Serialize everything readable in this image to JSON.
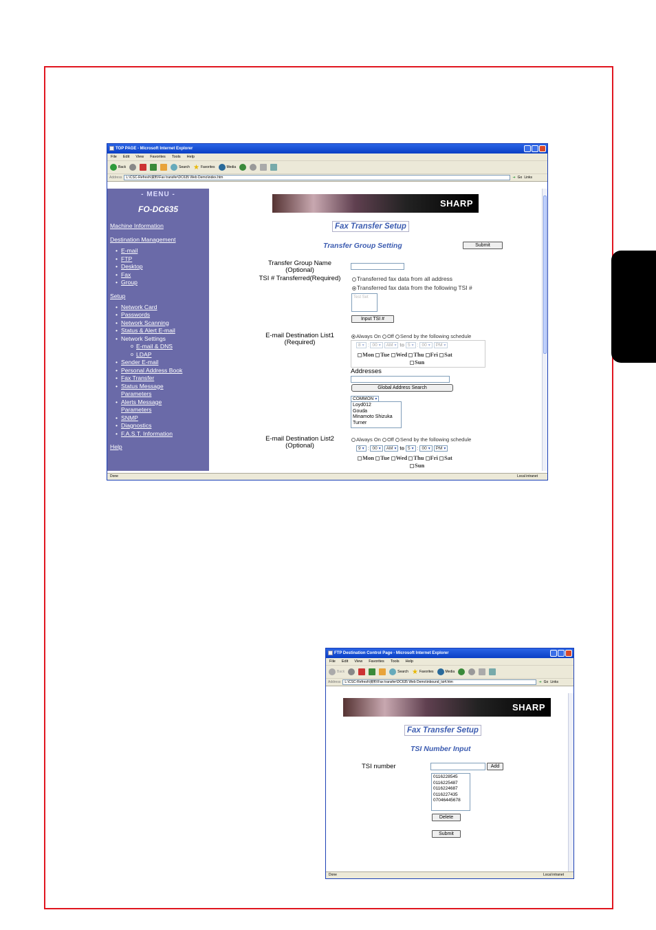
{
  "win1": {
    "title": "TOP PAGE - Microsoft Internet Explorer",
    "menus": [
      "File",
      "Edit",
      "View",
      "Favorites",
      "Tools",
      "Help"
    ],
    "toolbar": {
      "back": "Back",
      "search": "Search",
      "favorites": "Favorites",
      "media": "Media"
    },
    "address_label": "Address",
    "address": "L:\\CSC-Refresh\\資料\\Fax transfer\\DC635 Web Demo\\index.htm",
    "go": "Go",
    "links": "Links",
    "status_left": "Done",
    "status_right": "Local intranet",
    "sidebar": {
      "menu": "- MENU -",
      "model": "FO-DC635",
      "machine_info": "Machine Information",
      "destination": "Destination Management",
      "dest_items": [
        "E-mail",
        "FTP",
        "Desktop",
        "Fax",
        "Group"
      ],
      "setup": "Setup",
      "setup_items": [
        "Network Card",
        "Passwords",
        "Network Scanning",
        "Status & Alert E-mail",
        "Network Settings"
      ],
      "net_sub": [
        "E-mail & DNS",
        "LDAP"
      ],
      "setup_items2": [
        "Sender E-mail",
        "Personal Address Book",
        "Fax Transfer",
        "Status Message",
        "Parameters",
        "Alerts Message",
        "Parameters",
        "SNMP",
        "Diagnostics",
        "F.A.S.T. Information"
      ],
      "help": "Help"
    },
    "brand": "SHARP",
    "page_title": "Fax Transfer Setup",
    "section": "Transfer Group Setting",
    "submit": "Submit",
    "group_name_label": "Transfer Group Name\n(Optional)",
    "tsi_label": "TSI # Transferred(Required)",
    "tsi_opt1": "Transferred fax data from all address",
    "tsi_opt2": "Transferred fax data from the following TSI #",
    "tsi_list": "Test Set",
    "input_tsi": "Input TSI #",
    "list1_label": "E-mail Destination List1\n(Required)",
    "always_on": "Always On",
    "off": "Off",
    "schedule": "Send by the following schedule",
    "sched1": {
      "h1": "8",
      "m1": "00",
      "ap1": "AM",
      "to": "to",
      "h2": "5",
      "m2": "00",
      "ap2": "PM"
    },
    "days": [
      "Mon",
      "Tue",
      "Wed",
      "Thu",
      "Fri",
      "Sat"
    ],
    "sun": "Sun",
    "addresses": "Addresses",
    "global_search": "Global Address Search",
    "common": "COMMON",
    "address_list": [
      "Loyd012",
      "Gouda",
      "Minamoto Shizuka",
      "Turner"
    ],
    "list2_label": "E-mail Destination List2\n(Optional)",
    "sched2": {
      "h1": "9",
      "m1": "00",
      "ap1": "AM",
      "to": "to",
      "h2": "5",
      "m2": "00",
      "ap2": "PM"
    }
  },
  "win2": {
    "title": "FTP Destination Control Page - Microsoft Internet Explorer",
    "menus": [
      "File",
      "Edit",
      "View",
      "Favorites",
      "Tools",
      "Help"
    ],
    "toolbar": {
      "back": "Back",
      "search": "Search",
      "favorites": "Favorites",
      "media": "Media"
    },
    "address_label": "Address",
    "address": "L:\\CSC-Refresh\\資料\\Fax transfer\\DC635 Web Demo\\inbound_tsi4.htm",
    "go": "Go",
    "links": "Links",
    "status_left": "Done",
    "status_right": "Local intranet",
    "brand": "SHARP",
    "page_title": "Fax Transfer Setup",
    "section": "TSI Number Input",
    "tsi_label": "TSI number",
    "add": "Add",
    "tsi_numbers": [
      "0116228545",
      "0116225487",
      "0116224687",
      "0116227435",
      "07046445678"
    ],
    "delete": "Delete",
    "submit": "Submit"
  },
  "colors": {
    "frame": "#e0141e",
    "sidebar": "#6a6aa8",
    "accent": "#3b5bb0"
  }
}
